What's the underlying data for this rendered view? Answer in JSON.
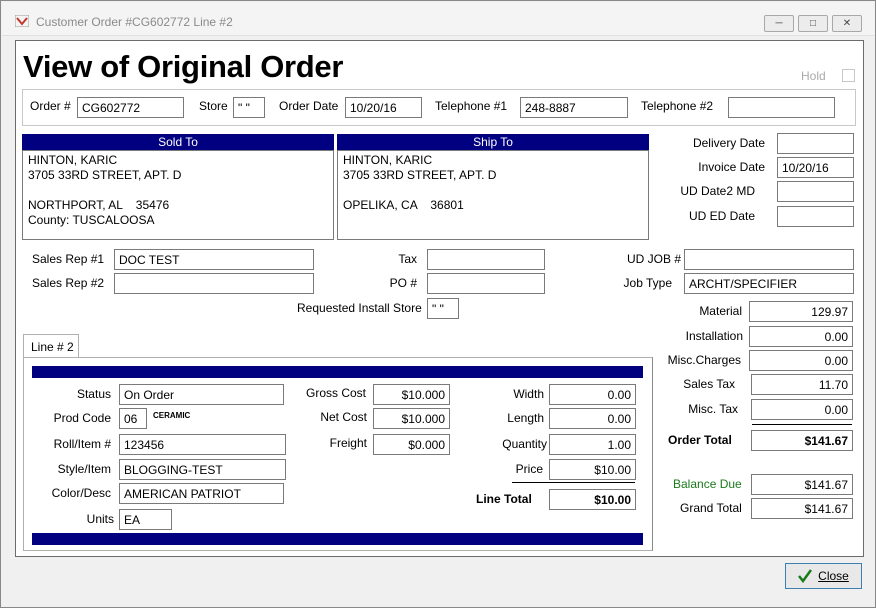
{
  "window": {
    "title": "Customer Order #CG602772    Line #2"
  },
  "header": {
    "title": "View of Original Order",
    "hold_label": "Hold"
  },
  "order_info": {
    "order_num_label": "Order #",
    "order_num": "CG602772",
    "store_label": "Store",
    "store": "\" \"",
    "order_date_label": "Order Date",
    "order_date": "10/20/16",
    "tel1_label": "Telephone #1",
    "tel1": "248-8887",
    "tel2_label": "Telephone #2",
    "tel2": ""
  },
  "sold_to": {
    "header": "Sold To",
    "lines": [
      "HINTON, KARIC",
      "3705 33RD STREET, APT. D",
      "",
      "NORTHPORT, AL    35476",
      "County: TUSCALOOSA"
    ]
  },
  "ship_to": {
    "header": "Ship To",
    "lines": [
      "HINTON, KARIC",
      "3705 33RD STREET, APT. D",
      "",
      "OPELIKA, CA    36801"
    ]
  },
  "dates": {
    "delivery_label": "Delivery Date",
    "delivery": "",
    "invoice_label": "Invoice Date",
    "invoice": "10/20/16",
    "ud_date2_label": "UD Date2 MD",
    "ud_date2": "",
    "ud_ed_label": "UD ED Date",
    "ud_ed": ""
  },
  "sales": {
    "rep1_label": "Sales Rep #1",
    "rep1": "DOC TEST",
    "rep2_label": "Sales Rep #2",
    "rep2": "",
    "tax_label": "Tax",
    "tax": "",
    "po_label": "PO #",
    "po": "",
    "req_store_label": "Requested Install Store",
    "req_store": "\" \"",
    "udjob_label": "UD JOB #",
    "udjob": "",
    "jobtype_label": "Job Type",
    "jobtype": "ARCHT/SPECIFIER"
  },
  "totals": {
    "material_label": "Material",
    "material": "129.97",
    "installation_label": "Installation",
    "installation": "0.00",
    "misc_label": "Misc.Charges",
    "misc": "0.00",
    "salestax_label": "Sales Tax",
    "salestax": "11.70",
    "misctax_label": "Misc. Tax",
    "misctax": "0.00",
    "order_total_label": "Order Total",
    "order_total": "$141.67",
    "balance_label": "Balance Due",
    "balance": "$141.67",
    "grand_label": "Grand Total",
    "grand": "$141.67"
  },
  "line": {
    "tab_label": "Line # 2",
    "status_label": "Status",
    "status": "On Order",
    "prodcode_label": "Prod Code",
    "prodcode": "06",
    "prodcode_desc": "CERAMIC",
    "roll_label": "Roll/Item #",
    "roll": "123456",
    "style_label": "Style/Item",
    "style": "BLOGGING-TEST",
    "color_label": "Color/Desc",
    "color": "AMERICAN PATRIOT",
    "units_label": "Units",
    "units": "EA",
    "gross_label": "Gross Cost",
    "gross": "$10.000",
    "net_label": "Net Cost",
    "net": "$10.000",
    "freight_label": "Freight",
    "freight": "$0.000",
    "width_label": "Width",
    "width": "0.00",
    "length_label": "Length",
    "length": "0.00",
    "qty_label": "Quantity",
    "qty": "1.00",
    "price_label": "Price",
    "price": "$10.00",
    "line_total_label": "Line Total",
    "line_total": "$10.00"
  },
  "footer": {
    "close_label": "Close"
  }
}
